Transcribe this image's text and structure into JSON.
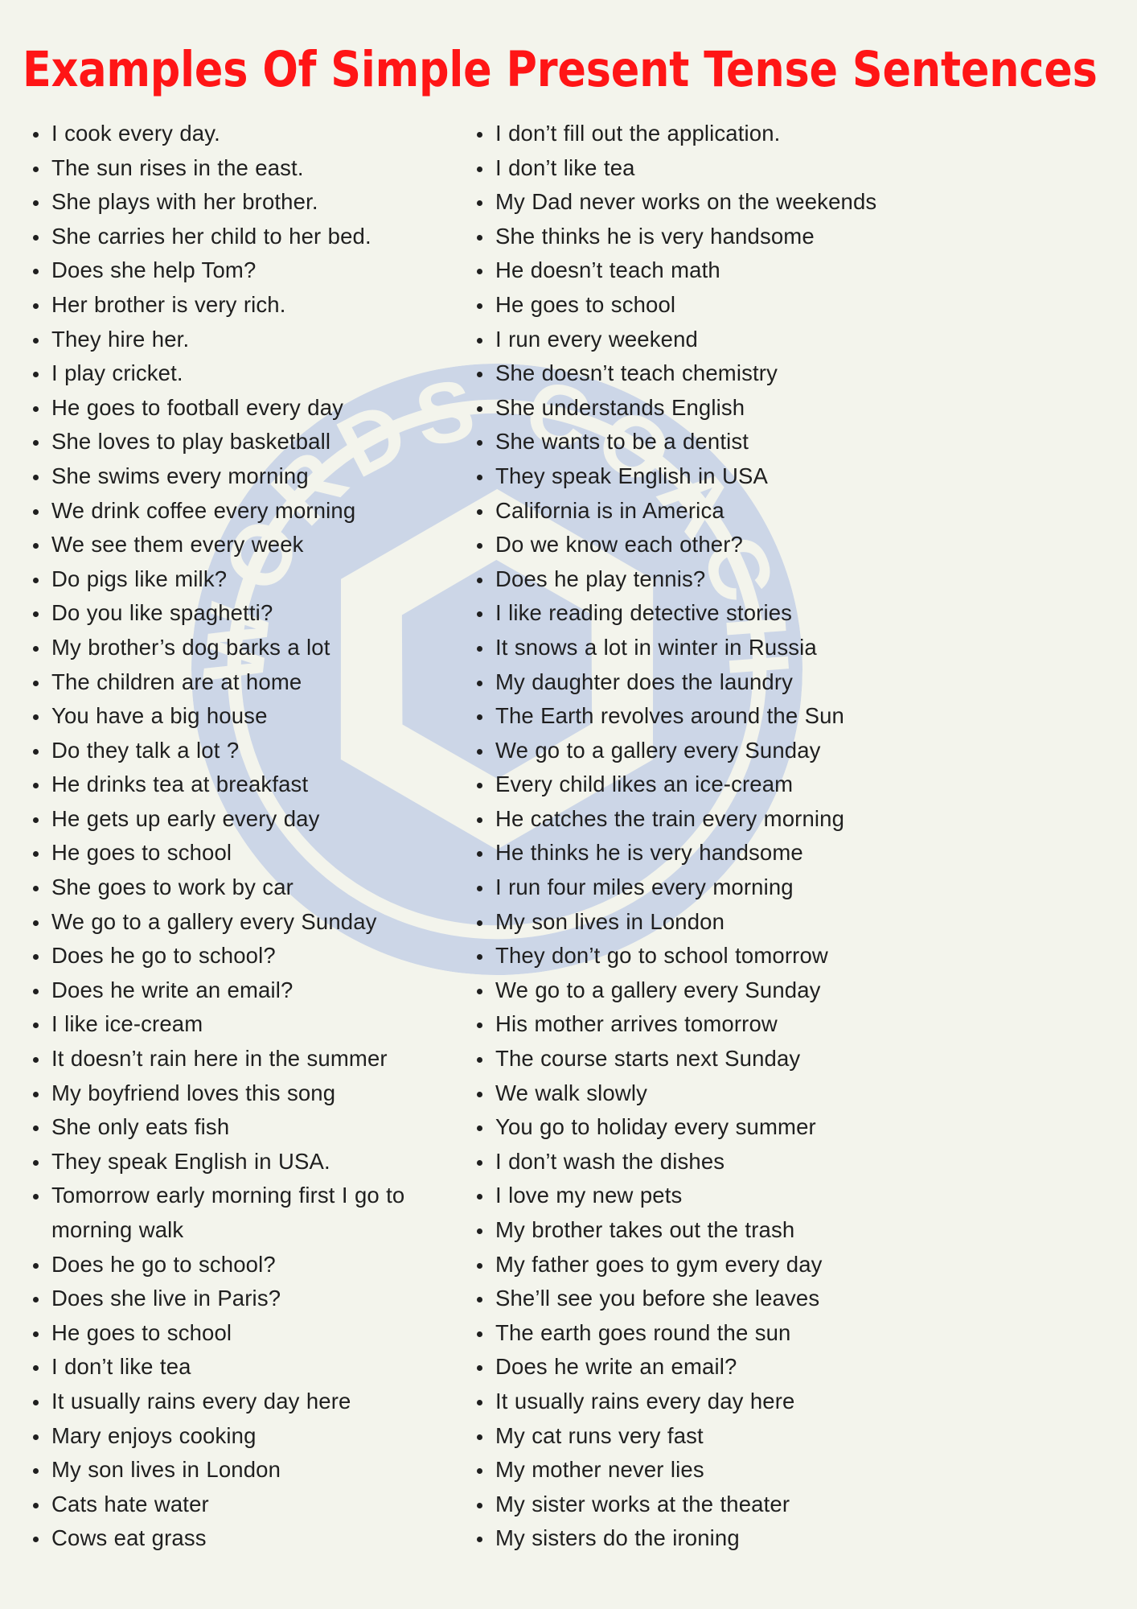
{
  "title": "Examples Of Simple Present Tense Sentences",
  "colors": {
    "background": "#f3f4ec",
    "title": "#ff1516",
    "text": "#1f1f1f",
    "watermark": "#ccd6e7"
  },
  "watermark": {
    "arc_text": "WORDS COACH",
    "shape": "camera-aperture-badge"
  },
  "columns": {
    "left": [
      "I cook every day.",
      "The sun rises in the east.",
      "She plays with her brother.",
      "She carries her child to her bed.",
      "Does she help Tom?",
      "Her brother is very rich.",
      "They hire her.",
      "I play cricket.",
      "He goes to football every day",
      "She loves to play basketball",
      "She swims every morning",
      "We drink coffee every morning",
      "We see them every week",
      "Do pigs like milk?",
      "Do you like spaghetti?",
      "My brother’s dog barks a lot",
      "The children are at home",
      "You have a big house",
      "Do they talk a lot ?",
      "He drinks tea at breakfast",
      "He gets up early every day",
      "He goes to school",
      "She goes to work by car",
      "We go to a gallery every Sunday",
      "Does he go to school?",
      "Does he write an email?",
      "I like ice-cream",
      "It doesn’t rain here in the summer",
      "My boyfriend loves this song",
      "She only eats fish",
      "They speak English in USA.",
      "Tomorrow early morning first I go to morning walk",
      "Does he go to school?",
      "Does she live in Paris?",
      "He goes to school",
      "I don’t like tea",
      "It usually rains every day here",
      "Mary enjoys cooking",
      "My son lives in London",
      "Cats hate water",
      "Cows eat grass"
    ],
    "right": [
      "I don’t fill out the application.",
      "I don’t like tea",
      "My Dad never works on the weekends",
      "She thinks he is very handsome",
      "He doesn’t teach math",
      "He goes to school",
      "I run every weekend",
      "She doesn’t teach chemistry",
      "She understands English",
      "She wants to be a dentist",
      "They speak English in USA",
      "California is in America",
      "Do we know each other?",
      "Does he play tennis?",
      "I like reading detective stories",
      "It snows a lot in winter in Russia",
      "My daughter does the laundry",
      "The Earth revolves around the Sun",
      "We go to a gallery every Sunday",
      "Every child likes an ice-cream",
      "He catches the train every morning",
      "He thinks he is very handsome",
      "I run four miles every morning",
      "My son lives in London",
      "They don’t go to school tomorrow",
      "We go to a gallery every Sunday",
      "His mother arrives tomorrow",
      "The course starts next Sunday",
      "We walk slowly",
      "You go to holiday every summer",
      "I don’t wash the dishes",
      "I love my new pets",
      "My brother takes out the trash",
      "My father goes to gym every day",
      "She’ll see you before she leaves",
      "The earth goes round the sun",
      "Does he write an email?",
      "It usually rains every day here",
      "My cat runs very fast",
      "My mother never lies",
      "My sister works at the theater",
      "My sisters do the ironing"
    ]
  }
}
